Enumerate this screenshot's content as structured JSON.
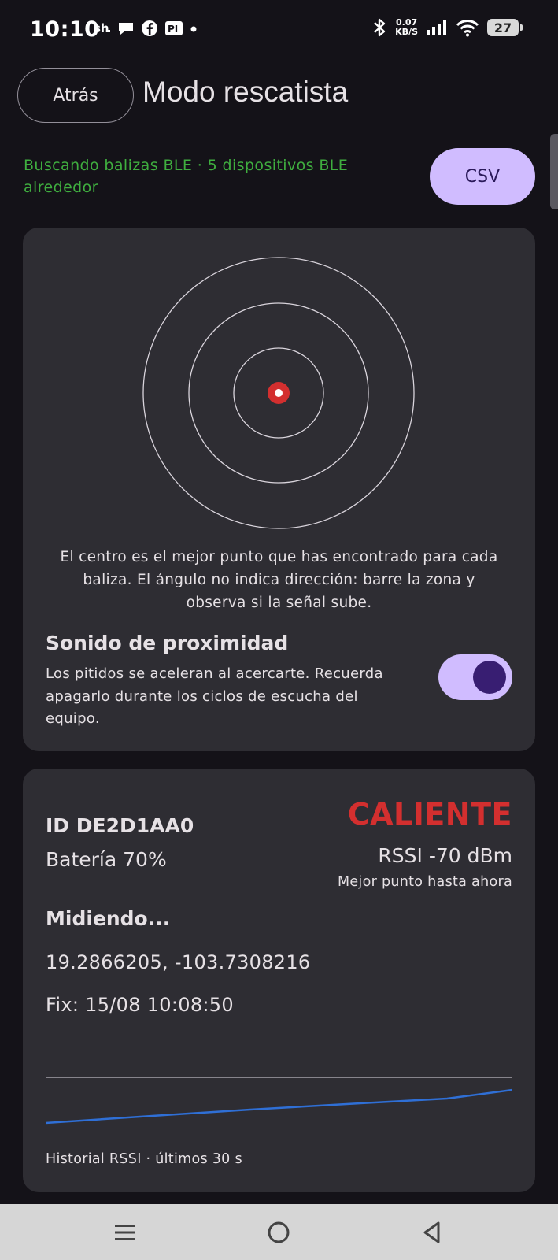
{
  "status_bar": {
    "time": "10:10",
    "net_speed_value": "0.07",
    "net_speed_unit": "KB/S",
    "battery_level": "27",
    "icons": [
      "sh-app-icon",
      "chat-bubble-icon",
      "facebook-icon",
      "pi-app-icon",
      "dot-icon",
      "bluetooth-icon",
      "signal-icon",
      "wifi-icon",
      "battery-icon"
    ]
  },
  "header": {
    "back_label": "Atrás",
    "title": "Modo rescatista"
  },
  "scan": {
    "status_text": "Buscando balizas BLE · 5 dispositivos BLE alrededor",
    "csv_label": "CSV"
  },
  "radar": {
    "caption": "El centro es el mejor punto que has encontrado para cada baliza. El ángulo no indica dirección: barre la zona y observa si la señal sube.",
    "colors": {
      "ring": "#d9d4dc",
      "target": "#d32f2f",
      "target_core": "#ffffff"
    }
  },
  "proximity_sound": {
    "title": "Sonido de proximidad",
    "description": "Los pitidos se aceleran al acercarte. Recuerda apagarlo durante los ciclos de escucha del equipo.",
    "enabled": true
  },
  "beacon": {
    "id_text": "ID DE2D1AA0",
    "battery_text": "Batería 70%",
    "heat_label": "CALIENTE",
    "rssi_text": "RSSI -70 dBm",
    "rssi_note": "Mejor punto hasta ahora",
    "measuring_text": "Midiendo...",
    "coordinates": "19.2866205, -103.7308216",
    "fix_text": "Fix: 15/08 10:08:50",
    "chart_caption": "Historial RSSI · últimos 30 s"
  },
  "colors": {
    "background": "#141218",
    "card": "#2e2d33",
    "accent": "#d0bcff",
    "status_green": "#3fae3f",
    "hot_red": "#d32f2f",
    "chart_line": "#2f6fd6"
  },
  "nav": {
    "icons": [
      "menu-icon",
      "home-circle-icon",
      "back-triangle-icon"
    ]
  }
}
